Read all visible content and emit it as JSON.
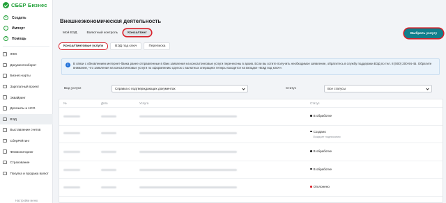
{
  "brand": {
    "name": "СБЕР Бизнес",
    "color": "#21a038"
  },
  "sidebar": {
    "actions": [
      {
        "label": "Создать",
        "icon": "plus-icon"
      },
      {
        "label": "Импорт",
        "icon": "import-icon"
      },
      {
        "label": "Помощь",
        "icon": "help-icon"
      }
    ],
    "items": [
      {
        "label": "ЖКХ",
        "icon": "house-icon"
      },
      {
        "label": "Документооборот",
        "icon": "documents-icon"
      },
      {
        "label": "Бизнес-карты",
        "icon": "card-icon"
      },
      {
        "label": "Зарплатный проект",
        "icon": "salary-icon"
      },
      {
        "label": "Эквайринг",
        "icon": "acquiring-icon"
      },
      {
        "label": "Депозиты и НСО",
        "icon": "deposit-icon"
      },
      {
        "label": "ВЭД",
        "icon": "globe-icon",
        "active": true
      },
      {
        "label": "Выставление счетов",
        "icon": "invoice-icon"
      },
      {
        "label": "СберРейтинг",
        "icon": "rating-icon"
      },
      {
        "label": "Финмониторинг",
        "icon": "monitor-icon"
      },
      {
        "label": "Страхование",
        "icon": "insurance-icon"
      },
      {
        "label": "Покупка и продажа валют",
        "icon": "currency-icon"
      }
    ],
    "settings_label": "Настройки меню"
  },
  "header": {
    "title": "Внешнеэкономическая деятельность",
    "tabs": [
      "Мой ВЭД",
      "Валютный контроль",
      "Консалтинг"
    ],
    "active_tab": 2,
    "primary_button": "Выбрать услугу"
  },
  "subtabs": {
    "items": [
      "Консалтинговые услуги",
      "ВЭД под ключ",
      "Переписка"
    ],
    "active": 0
  },
  "info": {
    "icon": "info-icon",
    "text": "В связи с обновлением интернет-банка ранее отправленные в банк заявления на консалтинговые услуги перенесены в архив. Если вы хотите получить необходимое заявление, обратитесь в службу поддержки ВЭД по тел. 8 (800) 200-94-45. Обратите внимание, что заявления на консалтинговые услуги по оформлению сделок с валютных операциях теперь находятся на вкладке «ВЭД под ключ»."
  },
  "filters": {
    "service_label": "Вид услуги",
    "service_value": "Справка о подтверждающих документах",
    "status_label": "Статус",
    "status_value": "Все статусы"
  },
  "table": {
    "columns": [
      "№",
      "Дата",
      "Услуга",
      "Статус"
    ],
    "rows": [
      {
        "status": "В обработке",
        "status_color": "#222222",
        "note": ""
      },
      {
        "status": "Создано",
        "status_color": "#222222",
        "note": "Ожидает подписания"
      },
      {
        "status": "В обработке",
        "status_color": "#222222",
        "note": ""
      },
      {
        "status": "В обработке",
        "status_color": "#222222",
        "note": ""
      },
      {
        "status": "Отклонено",
        "status_color": "#d9202a",
        "note": ""
      }
    ]
  },
  "colors": {
    "accent": "#107f8c",
    "highlight": "#d9202a",
    "info_bg": "#eaf3fb"
  }
}
